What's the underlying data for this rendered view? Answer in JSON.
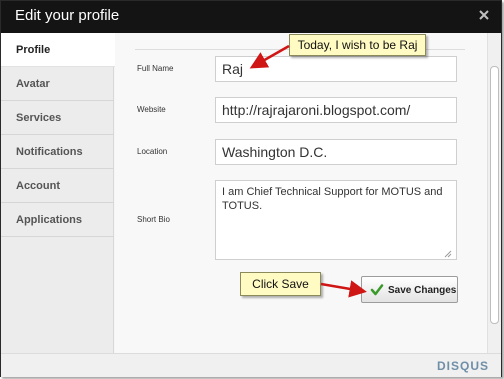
{
  "dialog": {
    "title": "Edit your profile",
    "close_icon": "close-icon"
  },
  "sidebar": {
    "items": [
      {
        "label": "Profile",
        "active": true
      },
      {
        "label": "Avatar"
      },
      {
        "label": "Services"
      },
      {
        "label": "Notifications"
      },
      {
        "label": "Account"
      },
      {
        "label": "Applications"
      }
    ]
  },
  "form": {
    "full_name": {
      "label": "Full Name",
      "value": "Raj"
    },
    "website": {
      "label": "Website",
      "value": "http://rajrajaroni.blogspot.com/"
    },
    "location": {
      "label": "Location",
      "value": "Washington D.C."
    },
    "short_bio": {
      "label": "Short Bio",
      "value": "I am Chief Technical Support for MOTUS and TOTUS."
    },
    "save_button": {
      "label": "Save Changes",
      "icon": "checkmark-icon"
    }
  },
  "annotations": {
    "callout_name": "Today, I wish to be Raj",
    "callout_save": "Click Save"
  },
  "footer": {
    "brand": "DISQUS"
  },
  "colors": {
    "titlebar": "#141414",
    "callout_fill": "#fffbc2",
    "arrow": "#d01515",
    "brand": "#6f8ea8",
    "checkmark": "#3a9a2a"
  }
}
